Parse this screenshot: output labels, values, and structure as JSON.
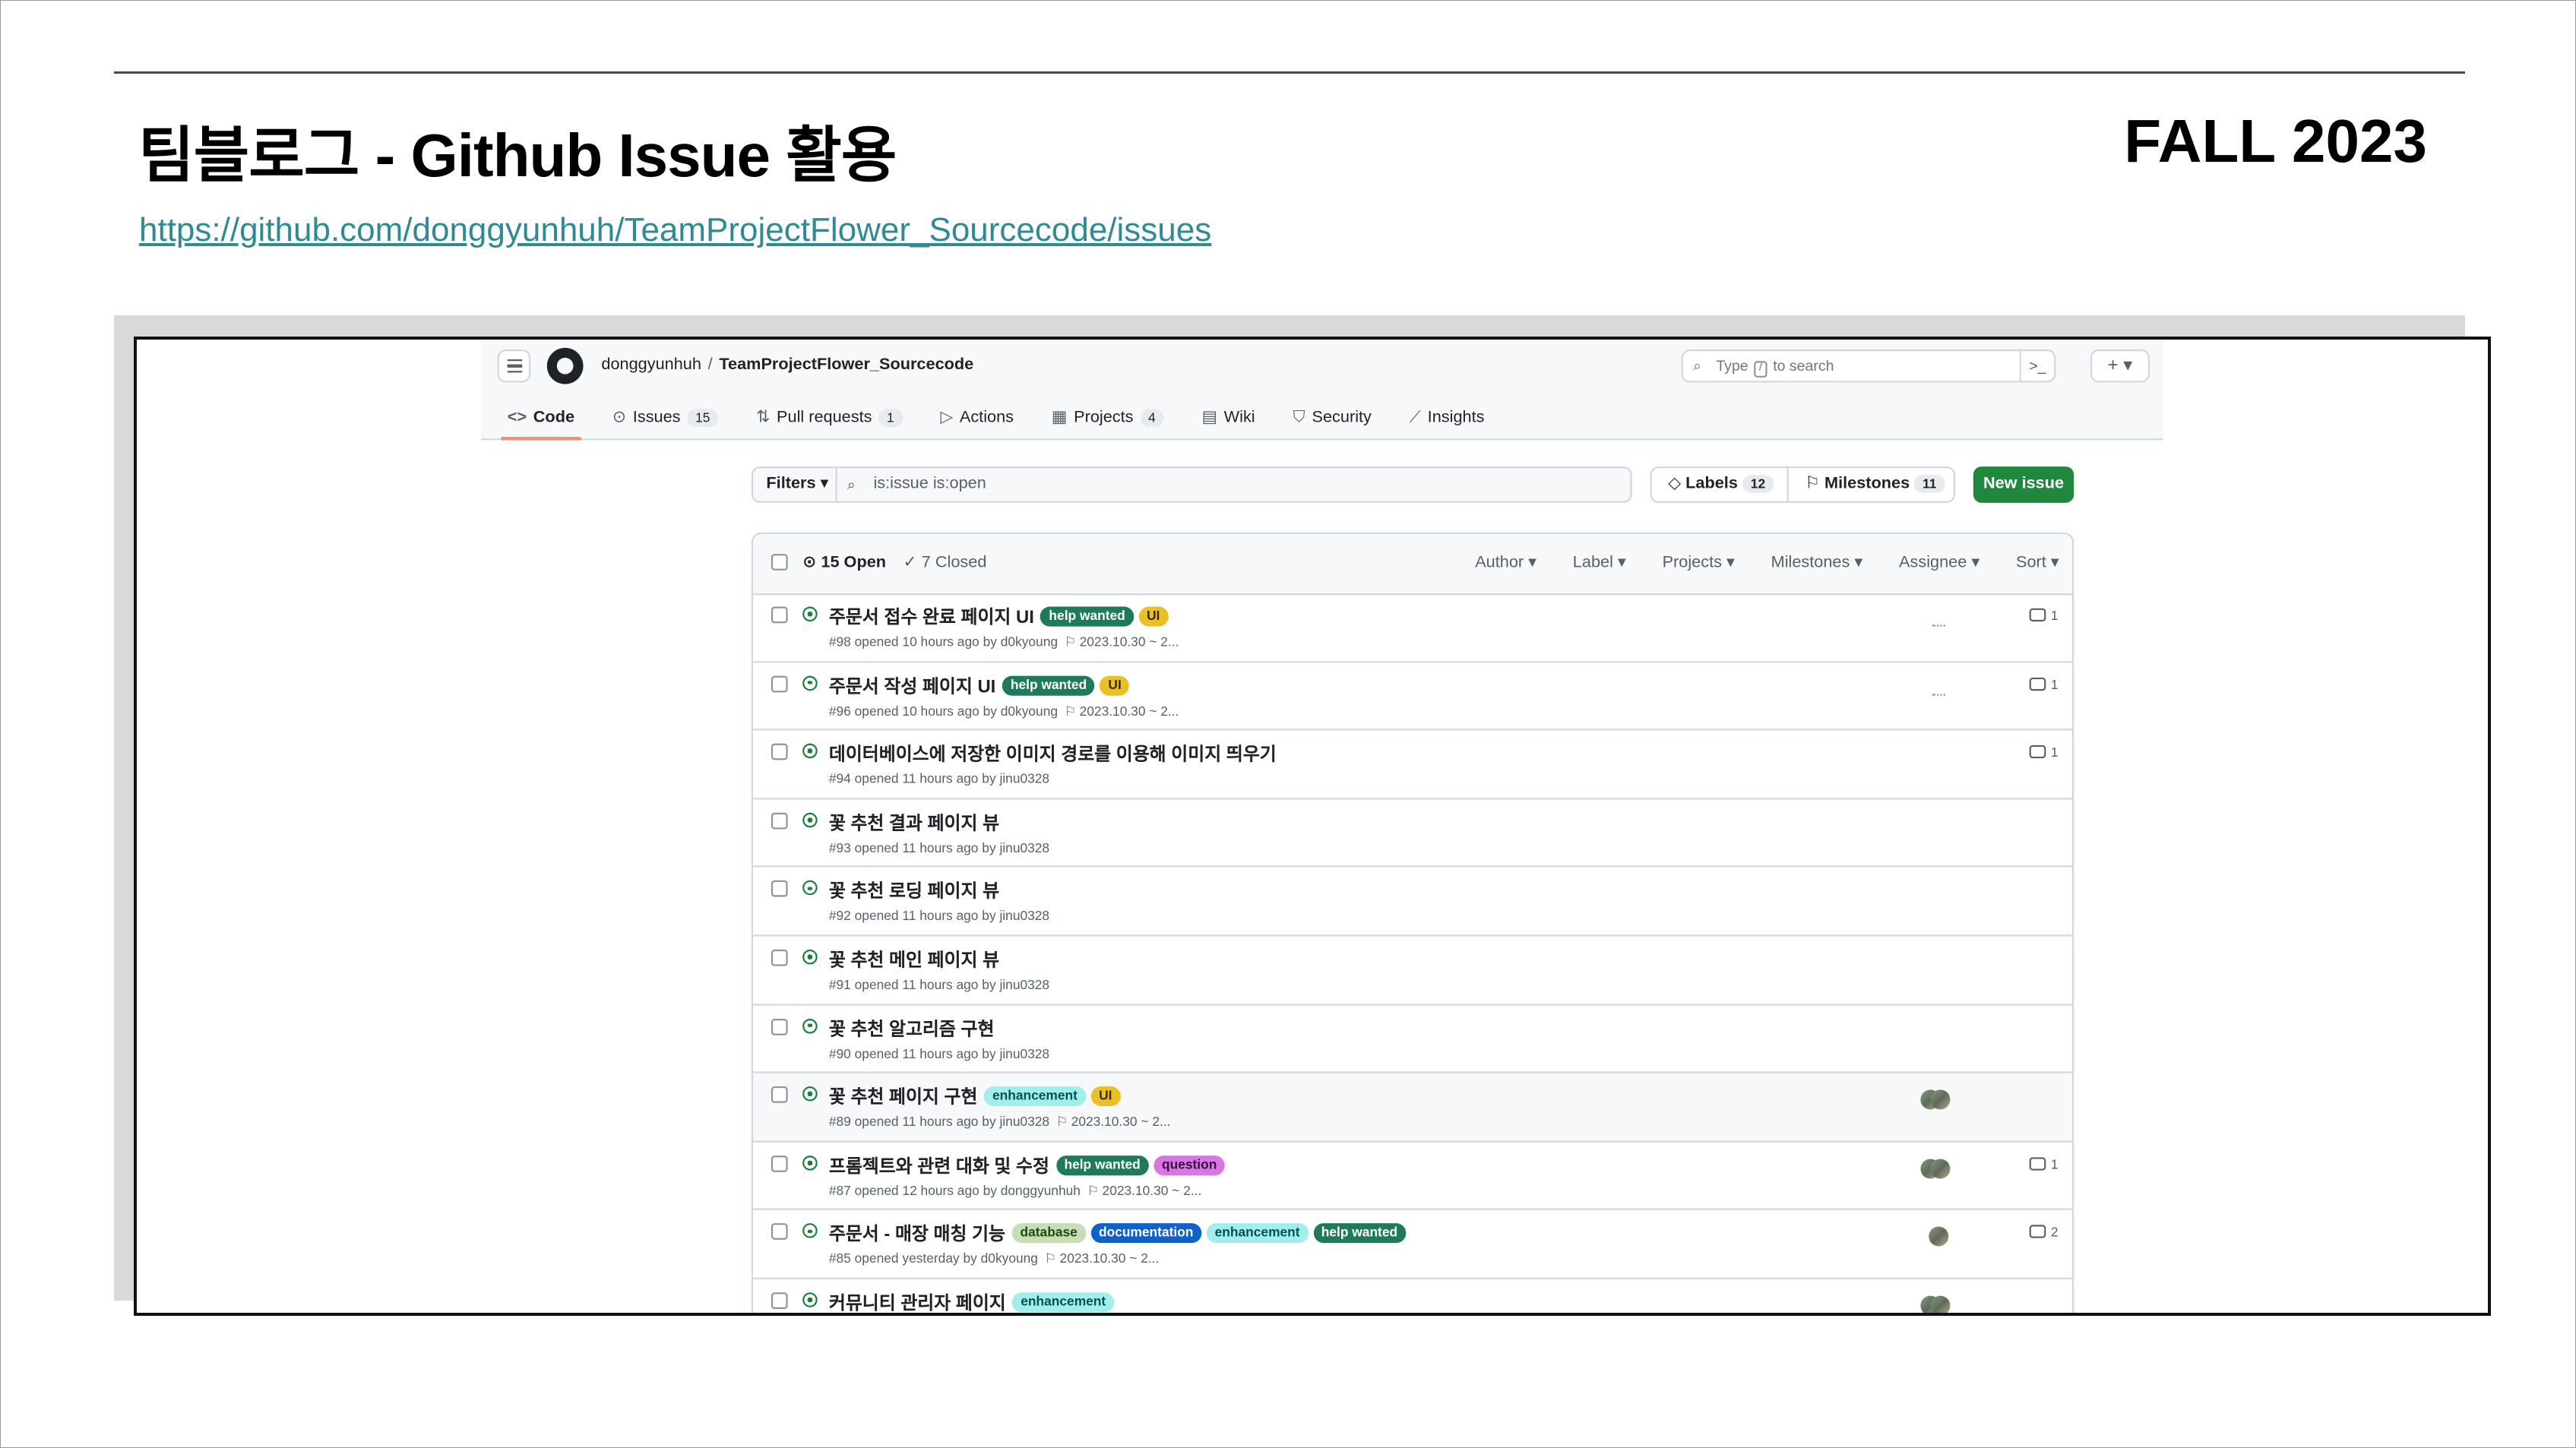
{
  "slide": {
    "title": "팀블로그 - Github Issue 활용",
    "term": "FALL 2023",
    "link": "https://github.com/donggyunhuh/TeamProjectFlower_Sourcecode/issues"
  },
  "github": {
    "repo_owner": "donggyunhuh",
    "repo_separator": "/",
    "repo_name": "TeamProjectFlower_Sourcecode",
    "search": {
      "prefix": "Type",
      "key": "/",
      "suffix": "to search",
      "command_icon": ">_"
    },
    "plus_label": "+ ▾",
    "tabs": [
      {
        "icon": "<>",
        "label": "Code",
        "count": ""
      },
      {
        "icon": "⊙",
        "label": "Issues",
        "count": "15"
      },
      {
        "icon": "⇅",
        "label": "Pull requests",
        "count": "1"
      },
      {
        "icon": "▷",
        "label": "Actions",
        "count": ""
      },
      {
        "icon": "▦",
        "label": "Projects",
        "count": "4"
      },
      {
        "icon": "▤",
        "label": "Wiki",
        "count": ""
      },
      {
        "icon": "⛉",
        "label": "Security",
        "count": ""
      },
      {
        "icon": "⟋",
        "label": "Insights",
        "count": ""
      }
    ],
    "filters_label": "Filters ▾",
    "filter_query": "is:issue is:open",
    "labels_label": "Labels",
    "labels_count": "12",
    "milestones_label": "Milestones",
    "milestones_count": "11",
    "new_issue_label": "New issue",
    "open_count": "15 Open",
    "closed_count": "7 Closed",
    "sort_menus": [
      "Author ▾",
      "Label ▾",
      "Projects ▾",
      "Milestones ▾",
      "Assignee ▾",
      "Sort ▾"
    ],
    "issues": [
      {
        "title": "주문서 접수 완료 페이지 UI",
        "labels": [
          {
            "text": "help wanted",
            "cls": "lb-help"
          },
          {
            "text": "UI",
            "cls": "lb-ui"
          }
        ],
        "meta": "#98 opened 10 hours ago by d0kyoung",
        "milestone": "2023.10.30 ~ 2...",
        "assignee": "faint",
        "comments": "1"
      },
      {
        "title": "주문서 작성 페이지 UI",
        "labels": [
          {
            "text": "help wanted",
            "cls": "lb-help"
          },
          {
            "text": "UI",
            "cls": "lb-ui"
          }
        ],
        "meta": "#96 opened 10 hours ago by d0kyoung",
        "milestone": "2023.10.30 ~ 2...",
        "assignee": "faint",
        "comments": "1"
      },
      {
        "title": "데이터베이스에 저장한 이미지 경로를 이용해 이미지 띄우기",
        "labels": [],
        "meta": "#94 opened 11 hours ago by jinu0328",
        "milestone": "",
        "assignee": "",
        "comments": "1"
      },
      {
        "title": "꽃 추천 결과 페이지 뷰",
        "labels": [],
        "meta": "#93 opened 11 hours ago by jinu0328",
        "milestone": "",
        "assignee": "",
        "comments": ""
      },
      {
        "title": "꽃 추천 로딩 페이지 뷰",
        "labels": [],
        "meta": "#92 opened 11 hours ago by jinu0328",
        "milestone": "",
        "assignee": "",
        "comments": ""
      },
      {
        "title": "꽃 추천 메인 페이지 뷰",
        "labels": [],
        "meta": "#91 opened 11 hours ago by jinu0328",
        "milestone": "",
        "assignee": "",
        "comments": ""
      },
      {
        "title": "꽃 추천 알고리즘 구현",
        "labels": [],
        "meta": "#90 opened 11 hours ago by jinu0328",
        "milestone": "",
        "assignee": "",
        "comments": ""
      },
      {
        "title": "꽃 추천 페이지 구현",
        "labels": [
          {
            "text": "enhancement",
            "cls": "lb-enh"
          },
          {
            "text": "UI",
            "cls": "lb-ui"
          }
        ],
        "meta": "#89 opened 11 hours ago by jinu0328",
        "milestone": "2023.10.30 ~ 2...",
        "assignee": "double",
        "comments": ""
      },
      {
        "title": "프롬젝트와 관련 대화 및 수정",
        "labels": [
          {
            "text": "help wanted",
            "cls": "lb-help"
          },
          {
            "text": "question",
            "cls": "lb-q"
          }
        ],
        "meta": "#87 opened 12 hours ago by donggyunhuh",
        "milestone": "2023.10.30 ~ 2...",
        "assignee": "double",
        "comments": "1"
      },
      {
        "title": "주문서 - 매장 매칭 기능",
        "labels": [
          {
            "text": "database",
            "cls": "lb-db"
          },
          {
            "text": "documentation",
            "cls": "lb-doc"
          },
          {
            "text": "enhancement",
            "cls": "lb-enh"
          },
          {
            "text": "help wanted",
            "cls": "lb-help"
          }
        ],
        "meta": "#85 opened yesterday by d0kyoung",
        "milestone": "2023.10.30 ~ 2...",
        "assignee": "single",
        "comments": "2"
      },
      {
        "title": "커뮤니티 관리자 페이지",
        "labels": [
          {
            "text": "enhancement",
            "cls": "lb-enh"
          }
        ],
        "meta": "",
        "milestone": "",
        "assignee": "double",
        "comments": ""
      }
    ]
  }
}
